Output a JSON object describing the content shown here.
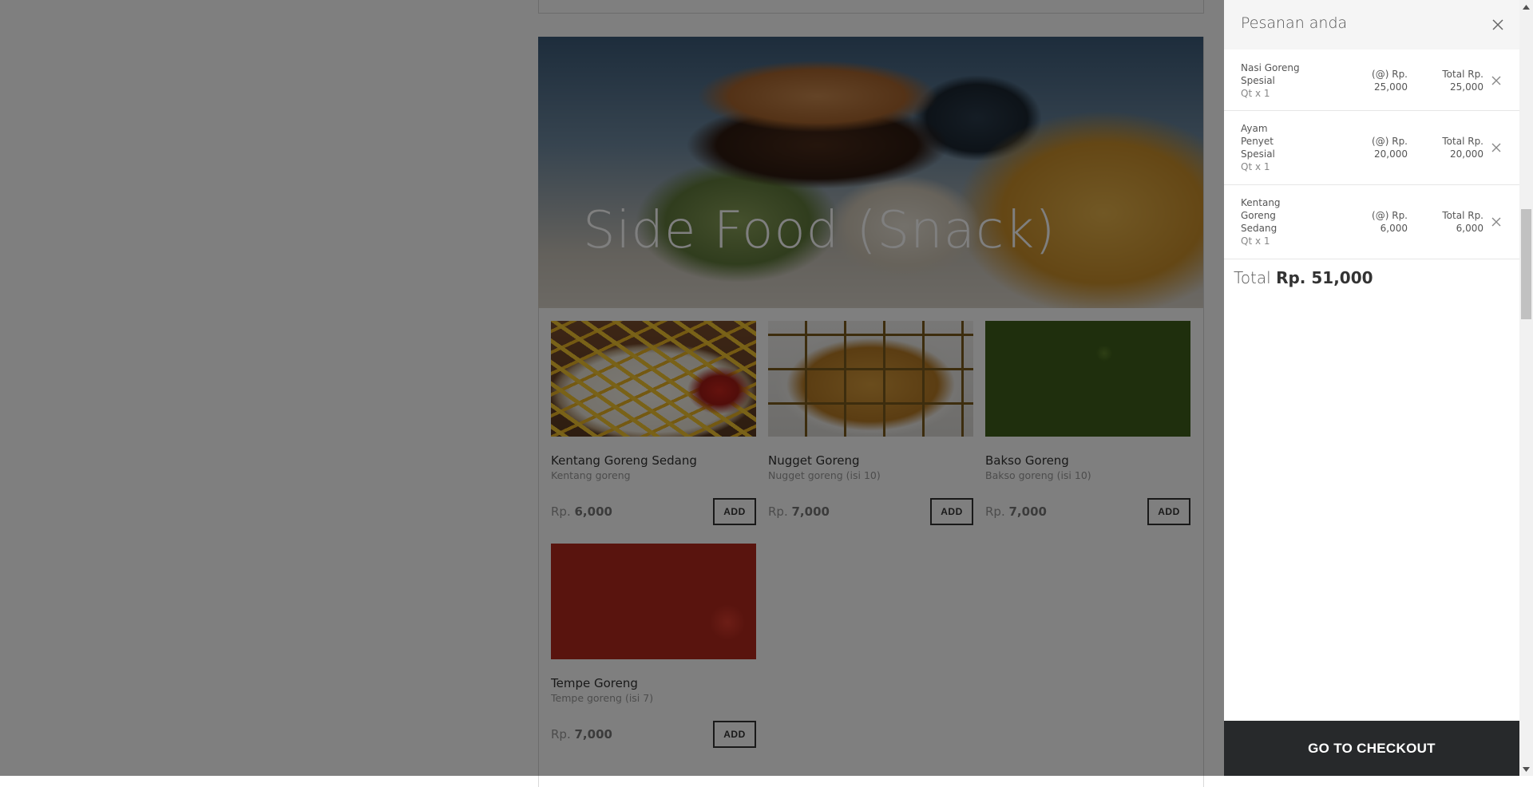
{
  "banner": {
    "title": "Side Food (Snack)"
  },
  "products": [
    {
      "name": "Kentang Goreng Sedang",
      "description": "Kentang goreng",
      "currency": "Rp.",
      "price": "6,000",
      "button": "ADD",
      "image": "fries-plate"
    },
    {
      "name": "Nugget Goreng",
      "description": "Nugget goreng (isi 10)",
      "currency": "Rp.",
      "price": "7,000",
      "button": "ADD",
      "image": "nugget-plate"
    },
    {
      "name": "Bakso Goreng",
      "description": "Bakso goreng (isi 10)",
      "currency": "Rp.",
      "price": "7,000",
      "button": "ADD",
      "image": "bakso-plate"
    },
    {
      "name": "Tempe Goreng",
      "description": "Tempe goreng (isi 7)",
      "currency": "Rp.",
      "price": "7,000",
      "button": "ADD",
      "image": "tempe-plate"
    }
  ],
  "cart": {
    "title": "Pesanan anda",
    "items": [
      {
        "name_lines": [
          "Nasi Goreng",
          "Spesial"
        ],
        "qty": "Qt x 1",
        "unit_lines": [
          "(@) Rp.",
          "25,000"
        ],
        "total_lines": [
          "Total Rp.",
          "25,000"
        ]
      },
      {
        "name_lines": [
          "Ayam",
          "Penyet",
          "Spesial"
        ],
        "qty": "Qt x 1",
        "unit_lines": [
          "(@) Rp.",
          "20,000"
        ],
        "total_lines": [
          "Total Rp.",
          "20,000"
        ]
      },
      {
        "name_lines": [
          "Kentang",
          "Goreng",
          "Sedang"
        ],
        "qty": "Qt x 1",
        "unit_lines": [
          "(@) Rp.",
          "6,000"
        ],
        "total_lines": [
          "Total Rp.",
          "6,000"
        ]
      }
    ],
    "total_label": "Total",
    "total_value": "Rp. 51,000",
    "checkout_label": "GO TO CHECKOUT"
  },
  "colors": {
    "overlay": "#000000",
    "checkout_bg": "#27292b",
    "drawer_header_bg": "#f5f5f5"
  },
  "icons": {
    "close": "close-icon",
    "remove": "remove-item-icon",
    "scroll_up": "chevron-up-icon",
    "scroll_down": "chevron-down-icon"
  }
}
